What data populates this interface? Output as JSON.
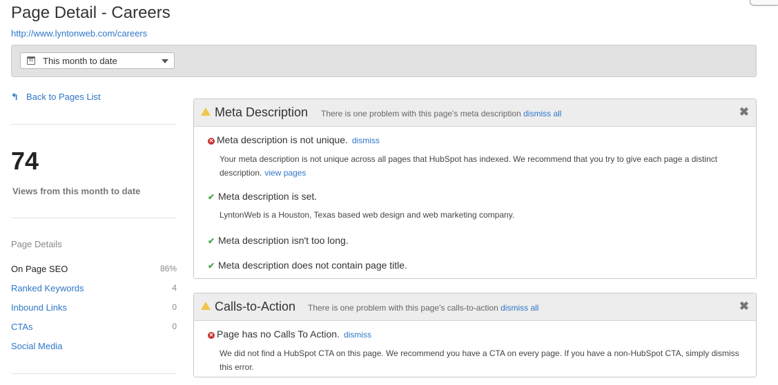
{
  "page": {
    "title": "Page Detail - Careers",
    "url": "http://www.lyntonweb.com/careers"
  },
  "filter": {
    "calendar_icon": "calendar-icon",
    "calendar_day": "31",
    "date_range": "This month to date"
  },
  "sidebar": {
    "back_label": "Back to Pages List",
    "views_count": "74",
    "views_label": "Views from this month to date",
    "details_heading": "Page Details",
    "items": [
      {
        "label": "On Page SEO",
        "value": "86%"
      },
      {
        "label": "Ranked Keywords",
        "value": "4"
      },
      {
        "label": "Inbound Links",
        "value": "0"
      },
      {
        "label": "CTAs",
        "value": "0"
      },
      {
        "label": "Social Media",
        "value": ""
      }
    ]
  },
  "meta_panel": {
    "title": "Meta Description",
    "message": "There is one problem with this page's meta description",
    "dismiss_all": "dismiss all",
    "checks": [
      {
        "status": "error",
        "title": "Meta description is not unique.",
        "action": "dismiss",
        "description": "Your meta description is not unique across all pages that HubSpot has indexed. We recommend that you try to give each page a distinct description.",
        "description_link": "view pages"
      },
      {
        "status": "ok",
        "title": "Meta description is set.",
        "description": "LyntonWeb is a Houston, Texas based web design and web marketing company."
      },
      {
        "status": "ok",
        "title": "Meta description isn't too long."
      },
      {
        "status": "ok",
        "title": "Meta description does not contain page title."
      }
    ]
  },
  "cta_panel": {
    "title": "Calls-to-Action",
    "message": "There is one problem with this page's calls-to-action",
    "dismiss_all": "dismiss all",
    "checks": [
      {
        "status": "error",
        "title": "Page has no Calls To Action.",
        "action": "dismiss",
        "description": "We did not find a HubSpot CTA on this page. We recommend you have a CTA on every page. If you have a non-HubSpot CTA, simply dismiss this error."
      }
    ]
  },
  "colors": {
    "link": "#2e77c8",
    "warning": "#f0c54a",
    "error": "#c9312d",
    "success": "#49a34b"
  }
}
